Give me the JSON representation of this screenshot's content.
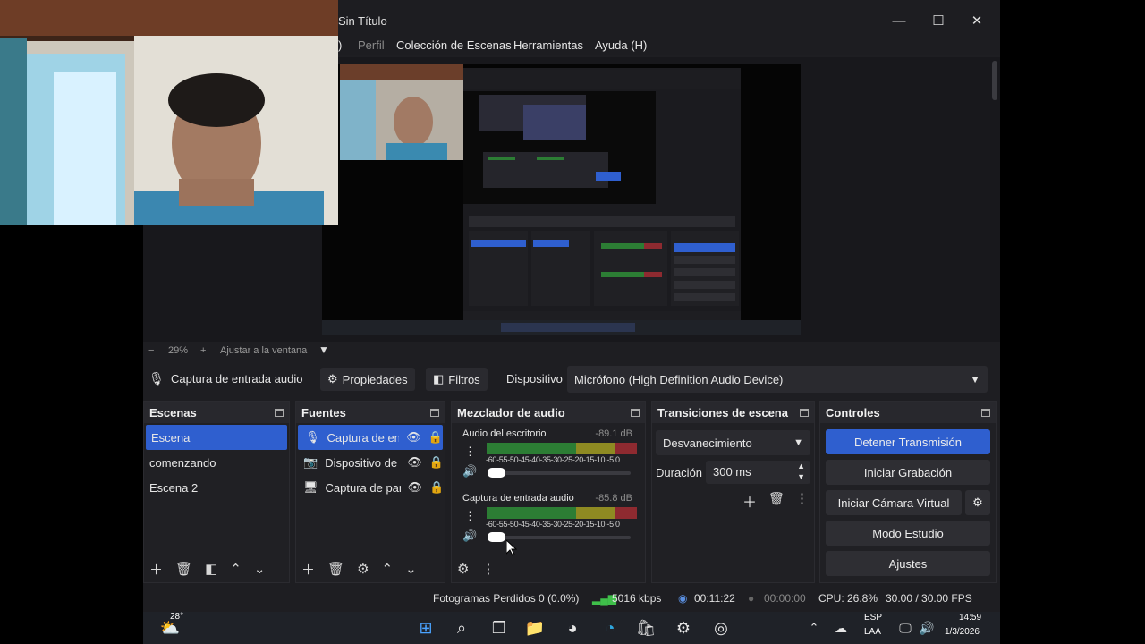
{
  "window": {
    "title": "Sin Título",
    "controls": {
      "minimize": "—",
      "maximize": "☐",
      "close": "✕"
    }
  },
  "menu": {
    "items": [
      ")",
      "Perfil",
      "Colección de Escenas",
      "Herramientas",
      "Ayuda (H)"
    ]
  },
  "zoom": {
    "minus": "−",
    "value": "29%",
    "plus": "+",
    "fit_label": "Ajustar a la ventana"
  },
  "source_toolbar": {
    "source_name": "Captura de entrada audio",
    "properties_label": "Propiedades",
    "filters_label": "Filtros",
    "device_label": "Dispositivo",
    "device_value": "Micrófono (High Definition Audio Device)"
  },
  "scenes": {
    "title": "Escenas",
    "items": [
      "Escena",
      "comenzando",
      "Escena 2"
    ]
  },
  "sources": {
    "title": "Fuentes",
    "items": [
      "Captura de entrada audio",
      "Dispositivo de captura de video",
      "Captura de pantalla"
    ]
  },
  "mixer": {
    "title": "Mezclador de audio",
    "ticks": "-60-55-50-45-40-35-30-25-20-15-10 -5  0",
    "channels": [
      {
        "name": "Audio del escritorio",
        "db": "-89.1 dB"
      },
      {
        "name": "Captura de entrada audio",
        "db": "-85.8 dB"
      }
    ]
  },
  "transitions": {
    "title": "Transiciones de escena",
    "selected": "Desvanecimiento",
    "duration_label": "Duración",
    "duration_value": "300 ms"
  },
  "controls": {
    "title": "Controles",
    "stop_stream": "Detener Transmisión",
    "start_recording": "Iniciar Grabación",
    "start_virtual_cam": "Iniciar Cámara Virtual",
    "studio_mode": "Modo Estudio",
    "settings": "Ajustes"
  },
  "status": {
    "dropped_frames": "Fotogramas Perdidos 0 (0.0%)",
    "bitrate": "5016 kbps",
    "stream_time": "00:11:22",
    "record_time": "00:00:00",
    "cpu": "CPU: 26.8%",
    "fps": "30.00 / 30.00 FPS"
  },
  "taskbar": {
    "weather_temp": "28°",
    "language_top": "ESP",
    "language_bottom": "LAA",
    "time": "14:59",
    "date": "1/3/2026"
  },
  "colors": {
    "accent": "#2f5fcf",
    "panel": "#202024",
    "meter_green": "#2c7d34",
    "meter_yellow": "#8e8a22",
    "meter_red": "#8e2a30"
  }
}
